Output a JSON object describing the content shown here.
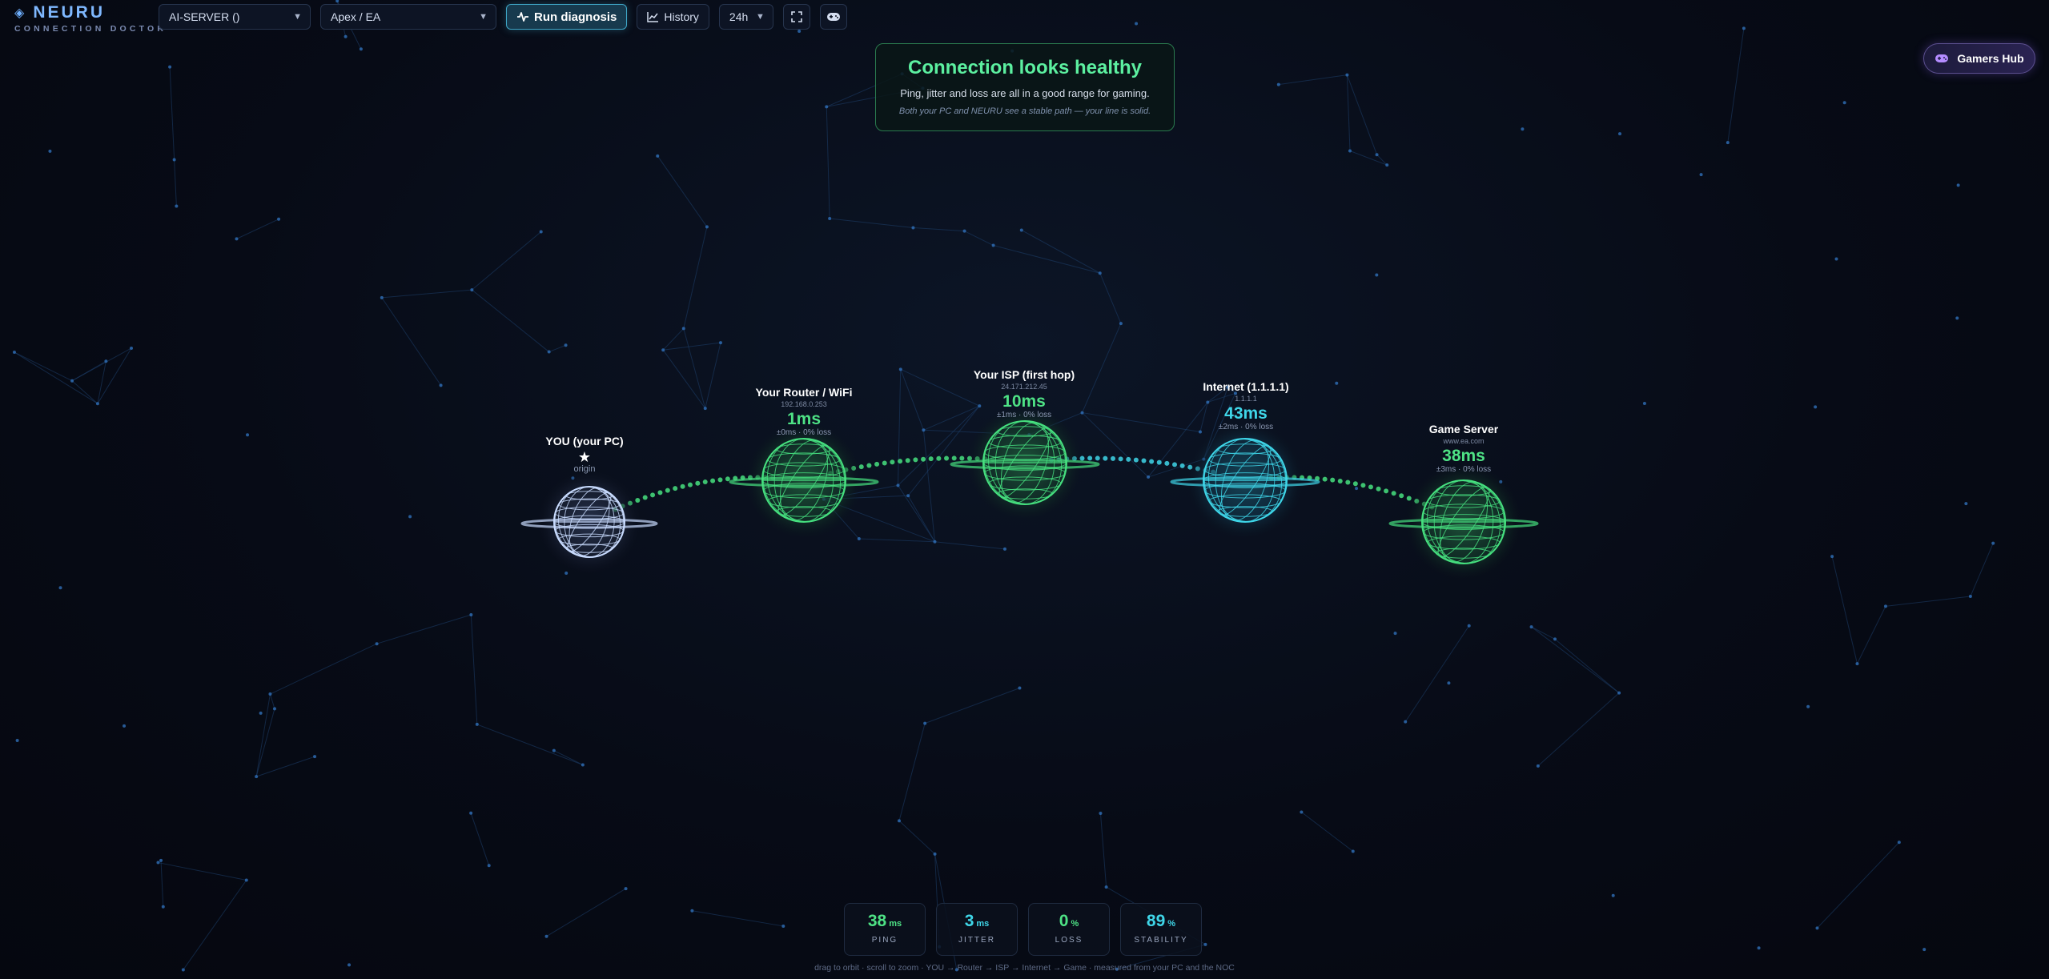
{
  "app": {
    "name": "NEURU",
    "subtitle": "CONNECTION DOCTOR"
  },
  "toolbar": {
    "server_select": "AI-SERVER ()",
    "game_select": "Apex / EA",
    "run_label": "Run diagnosis",
    "history_label": "History",
    "range_select": "24h"
  },
  "status": {
    "title": "Connection looks healthy",
    "line": "Ping, jitter and loss are all in a good range for gaming.",
    "note": "Both your PC and NEURU see a stable path — your line is solid."
  },
  "hub": {
    "label": "Gamers Hub"
  },
  "nodes": [
    {
      "name": "YOU (your PC)",
      "star": "★",
      "origin": "origin",
      "color": "#c9dcff"
    },
    {
      "name": "Your Router / WiFi",
      "ip": "192.168.0.253",
      "ms": "1ms",
      "sub": "±0ms · 0% loss",
      "color": "#46e07f"
    },
    {
      "name": "Your ISP (first hop)",
      "ip": "24.171.212.45",
      "ms": "10ms",
      "sub": "±1ms · 0% loss",
      "color": "#46e07f"
    },
    {
      "name": "Internet (1.1.1.1)",
      "ip": "1.1.1.1",
      "ms": "43ms",
      "sub": "±2ms · 0% loss",
      "color": "#3fd6e8"
    },
    {
      "name": "Game Server",
      "ip": "www.ea.com",
      "ms": "38ms",
      "sub": "±3ms · 0% loss",
      "color": "#46e07f"
    }
  ],
  "metrics": {
    "ping": {
      "value": "38",
      "unit": "ms",
      "label": "PING",
      "color": "#4ee285"
    },
    "jitter": {
      "value": "3",
      "unit": "ms",
      "label": "JITTER",
      "color": "#3fd6e8"
    },
    "loss": {
      "value": "0",
      "unit": "%",
      "label": "LOSS",
      "color": "#4ee285"
    },
    "stability": {
      "value": "89",
      "unit": "%",
      "label": "STABILITY",
      "color": "#3fd6e8"
    }
  },
  "footer": "drag to orbit · scroll to zoom · YOU → Router → ISP → Internet → Game · measured from your PC and the NOC"
}
